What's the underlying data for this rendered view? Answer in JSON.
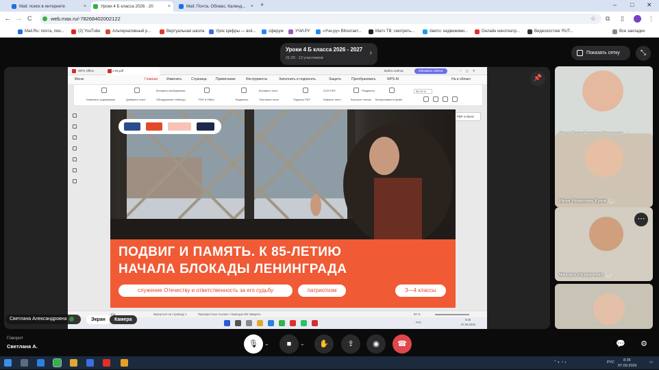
{
  "browser": {
    "tabs": [
      {
        "label": "Mail: поиск в интернете",
        "active": false
      },
      {
        "label": "Уроки 4 Б класса 2026 · 20",
        "active": true
      },
      {
        "label": "Mail: Почта, Облако, Календ...",
        "active": false
      }
    ],
    "new_tab": "+",
    "window_controls": [
      "–",
      "□",
      "✕"
    ],
    "nav": {
      "back": "←",
      "forward": "→",
      "reload": "C"
    },
    "url": "web.max.ru/-78268402002122",
    "bookmarks": [
      {
        "label": "Mail.Ru: почта, пои...",
        "color": "#1f6fe0"
      },
      {
        "label": "(2) YouTube",
        "color": "#e62117"
      },
      {
        "label": "Альтернативный р...",
        "color": "#d04a2a"
      },
      {
        "label": "Виртуальная школа",
        "color": "#e03a2a"
      },
      {
        "label": "Урок Цифры — всё...",
        "color": "#3b6fe0"
      },
      {
        "label": "сферум",
        "color": "#2787f5"
      },
      {
        "label": "УЧИ.РУ",
        "color": "#9b59b6"
      },
      {
        "label": "«Учи.ру» ВКонтакт...",
        "color": "#2787f5"
      },
      {
        "label": "Матч ТВ: смотреть...",
        "color": "#222222"
      },
      {
        "label": "Авито: недвижимо...",
        "color": "#19a0e6"
      },
      {
        "label": "Онлайн кинотеатр...",
        "color": "#e0302a"
      },
      {
        "label": "Видеохостинг RUT...",
        "color": "#333333"
      }
    ],
    "all_bookmarks": "Все закладки"
  },
  "meeting": {
    "title": "Уроки 4 Б класса 2026 - 2027",
    "subtitle": "21:29 · 13 участников",
    "grid_button": "Показать сетку",
    "speaker_label": "Светлана Александровна",
    "chip_screen": "Экран",
    "chip_camera": "Камера",
    "speaking_label": "Говорит",
    "speaking_name": "Светлана А."
  },
  "participants": [
    {
      "name": "Илья Тимофеевич Глущенко",
      "bg": "#d8dcd9",
      "face": "#e5b9a0"
    },
    {
      "name": "Иван Иванович Крюк",
      "bg": "#cfc4b4",
      "face": "#e6bfa4"
    },
    {
      "name": "Михаил Назарченко",
      "bg": "#d3cdc2",
      "face": "#cf9f7e"
    },
    {
      "name": "",
      "bg": "#c9c3b6",
      "face": "#e4c0a8"
    }
  ],
  "wps": {
    "app": "WPS Office",
    "file": "2.06.pdf",
    "signin": "Войти сейчас",
    "update": "Обновите сейчас",
    "menu": [
      "Меню",
      "Главная",
      "Изменить",
      "Страница",
      "Примечание",
      "Инструменты",
      "Заполнить и подписать",
      "Защита",
      "Преобразовать",
      "WPS AI",
      "На в облако"
    ],
    "toolbar": [
      "Изменить содержимое",
      "Добавить текст",
      "Вставить изображение",
      "Обнаружение таблицы",
      "PDF в Office",
      "Выделить",
      "Вставить текст",
      "Текстовое поле",
      "Подпись PDF",
      "Извлечь текст",
      "OCR PDF",
      "Быстрое чтение",
      "Разделить",
      "90,76 %",
      "Воспроизвести файл"
    ],
    "pdf_to_word": "PDF в Word",
    "status": [
      "1/11",
      "Вернуться на страницу 1",
      "Перекрестные ссылки с помощью ИИ-Эмерить",
      "90 %"
    ],
    "clock_time": "8:35",
    "clock_date": "07.09.2026",
    "lang": "РУС"
  },
  "slide": {
    "title_line1": "ПОДВИГ И ПАМЯТЬ. К 85-ЛЕТИЮ",
    "title_line2": "НАЧАЛА БЛОКАДЫ ЛЕНИНГРАДА",
    "pills": [
      "служение Отечеству и ответственность за его судьбу",
      "патриотизм",
      "3—4 классы"
    ]
  },
  "os": {
    "time": "8:35",
    "date": "07.09.2026",
    "lang": "РУС"
  },
  "colors": {
    "accent": "#f05a35",
    "end_call": "#e0474c",
    "muted_mic": "#ffffff"
  }
}
